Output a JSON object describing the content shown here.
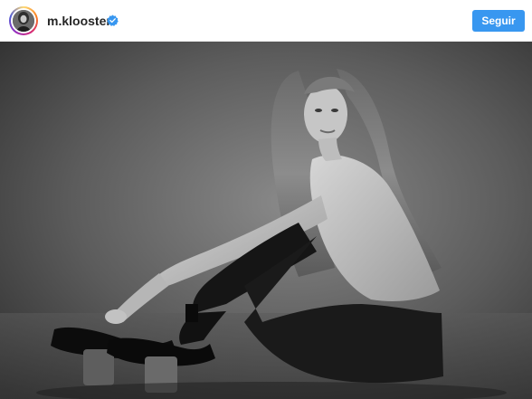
{
  "post": {
    "username": "m.klooster",
    "verified": true,
    "follow_label": "Seguir"
  },
  "photo": {
    "alt": "Black and white studio portrait of a woman with long hair sitting on the floor, hugging her knees, wearing dark jeans and platform heels"
  },
  "icons": {
    "verified": "verified-badge-icon",
    "avatar": "profile-avatar"
  },
  "colors": {
    "follow_button": "#3897f0",
    "verified_badge": "#3897f0",
    "username": "#262626"
  }
}
